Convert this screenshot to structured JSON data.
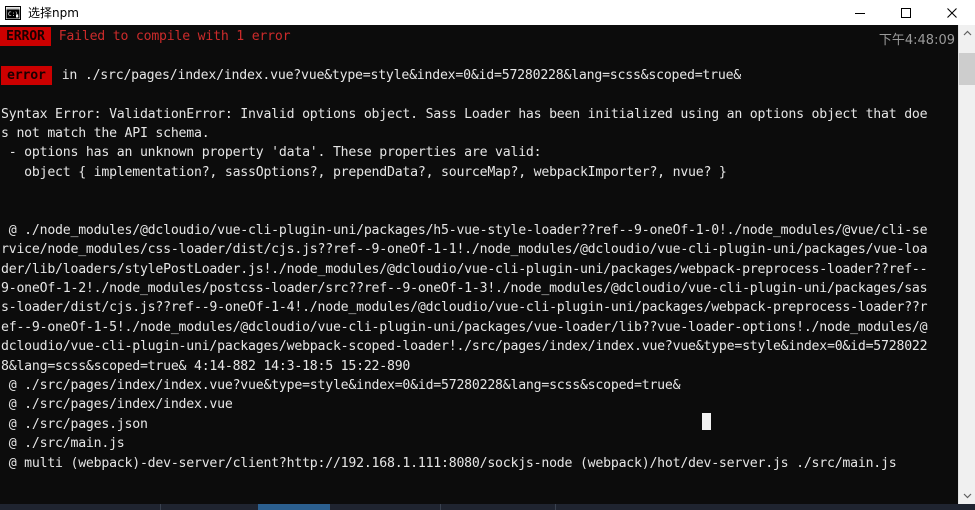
{
  "window": {
    "title": "选择npm",
    "icon": "cmd-console-icon",
    "controls": {
      "minimize": "minimize-icon",
      "maximize": "maximize-icon",
      "close": "close-icon"
    }
  },
  "colors": {
    "console_bg": "#0c0c0c",
    "console_fg": "#e6e6e6",
    "badge_bg": "#cc0000",
    "badge_fg": "#1a0000",
    "error_text": "#cc2b2b",
    "clock": "#9a9a9a",
    "titlebar_bg": "#ffffff",
    "scrollbar_thumb": "#cdcdcd"
  },
  "console": {
    "clock": "下午4:48:09",
    "badge_error_upper": "ERROR",
    "badge_error_lower": "error",
    "headline": "Failed to compile with 1 error",
    "error_location": "in ./src/pages/index/index.vue?vue&type=style&index=0&id=57280228&lang=scss&scoped=true&",
    "lines": [
      "Syntax Error: ValidationError: Invalid options object. Sass Loader has been initialized using an options object that doe",
      "s not match the API schema.",
      " - options has an unknown property 'data'. These properties are valid:",
      "   object { implementation?, sassOptions?, prependData?, sourceMap?, webpackImporter?, nvue? }",
      "",
      "",
      " @ ./node_modules/@dcloudio/vue-cli-plugin-uni/packages/h5-vue-style-loader??ref--9-oneOf-1-0!./node_modules/@vue/cli-se",
      "rvice/node_modules/css-loader/dist/cjs.js??ref--9-oneOf-1-1!./node_modules/@dcloudio/vue-cli-plugin-uni/packages/vue-loa",
      "der/lib/loaders/stylePostLoader.js!./node_modules/@dcloudio/vue-cli-plugin-uni/packages/webpack-preprocess-loader??ref--",
      "9-oneOf-1-2!./node_modules/postcss-loader/src??ref--9-oneOf-1-3!./node_modules/@dcloudio/vue-cli-plugin-uni/packages/sas",
      "s-loader/dist/cjs.js??ref--9-oneOf-1-4!./node_modules/@dcloudio/vue-cli-plugin-uni/packages/webpack-preprocess-loader??r",
      "ef--9-oneOf-1-5!./node_modules/@dcloudio/vue-cli-plugin-uni/packages/vue-loader/lib??vue-loader-options!./node_modules/@",
      "dcloudio/vue-cli-plugin-uni/packages/webpack-scoped-loader!./src/pages/index/index.vue?vue&type=style&index=0&id=5728022",
      "8&lang=scss&scoped=true& 4:14-882 14:3-18:5 15:22-890",
      " @ ./src/pages/index/index.vue?vue&type=style&index=0&id=57280228&lang=scss&scoped=true&",
      " @ ./src/pages/index/index.vue",
      " @ ./src/pages.json",
      " @ ./src/main.js",
      " @ multi (webpack)-dev-server/client?http://192.168.1.111:8080/sockjs-node (webpack)/hot/dev-server.js ./src/main.js"
    ]
  },
  "scrollbar": {
    "up_arrow": "chevron-up-icon",
    "down_arrow": "chevron-down-icon",
    "thumb": "scrollbar-thumb"
  }
}
